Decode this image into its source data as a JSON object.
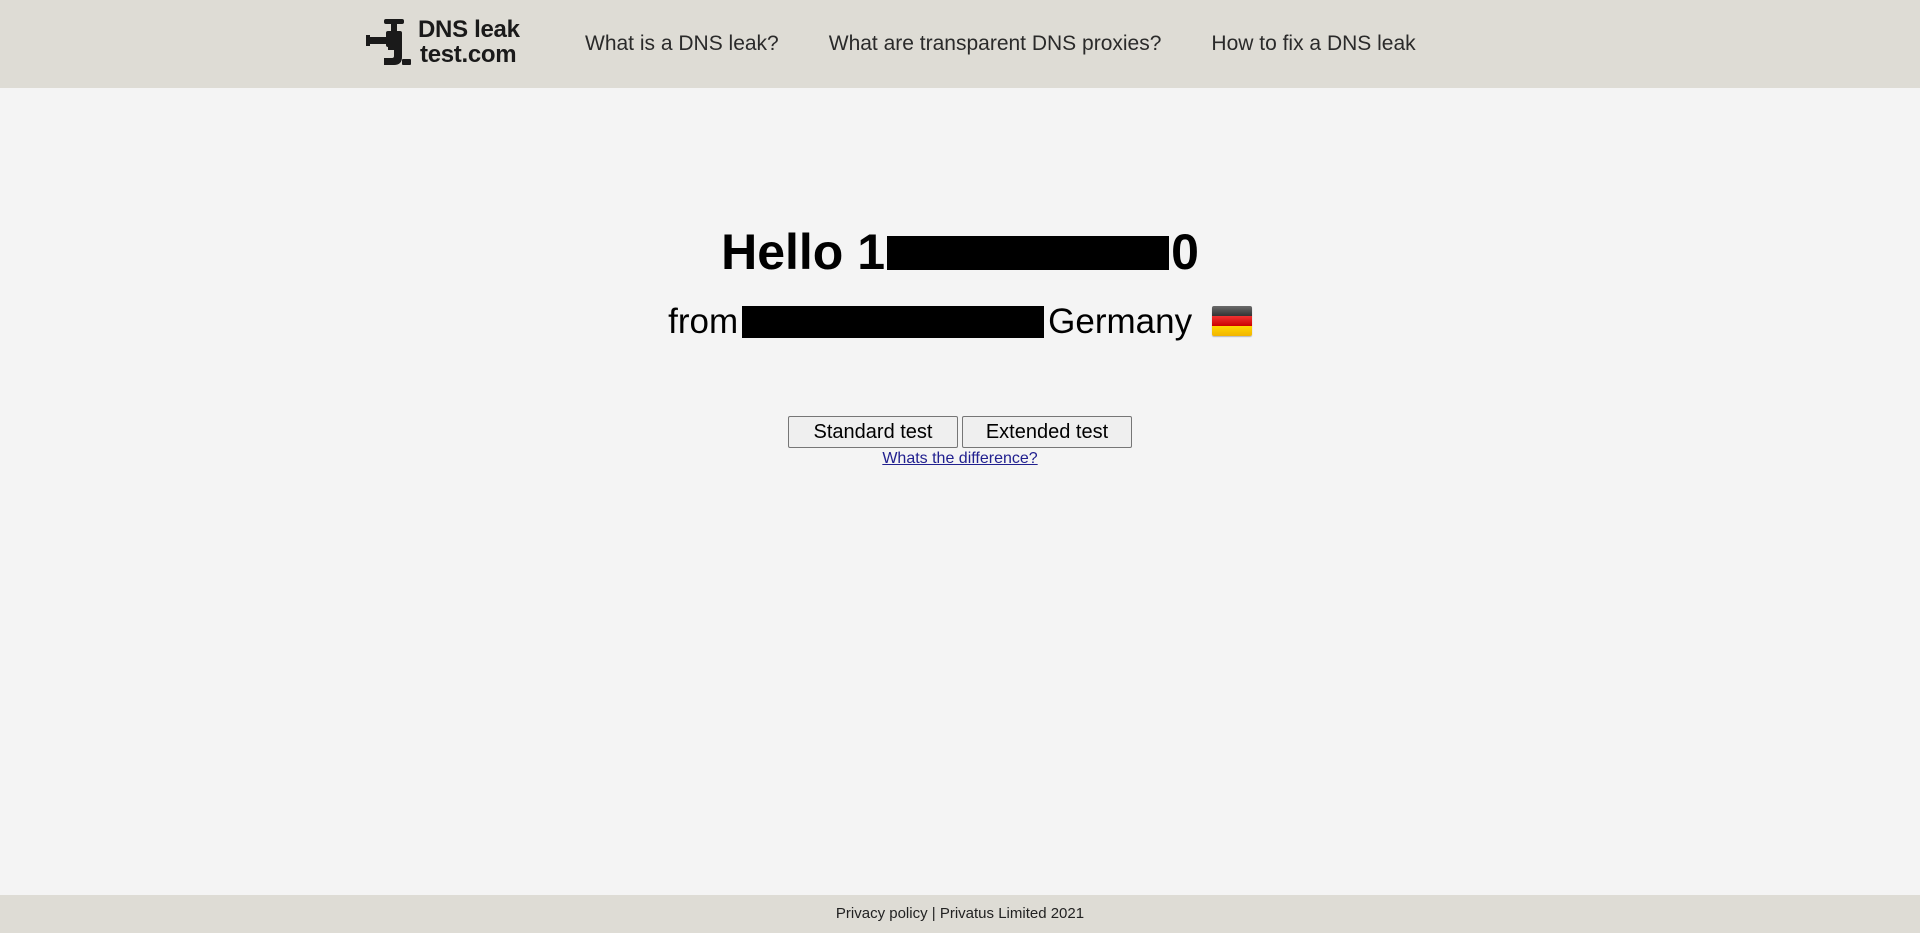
{
  "header": {
    "logo": {
      "line1": "DNS leak",
      "line2": "test.com",
      "icon": "faucet-icon"
    },
    "nav": [
      {
        "label": "What is a DNS leak?"
      },
      {
        "label": "What are transparent DNS proxies?"
      },
      {
        "label": "How to fix a DNS leak"
      }
    ]
  },
  "greeting": {
    "hello_prefix": "Hello 1",
    "hello_suffix": "0",
    "from_prefix": "from",
    "country": "Germany",
    "flag_icon": "germany-flag-icon",
    "flag_colors": [
      "#000000",
      "#dd0000",
      "#ffce00"
    ]
  },
  "actions": {
    "standard_label": "Standard test",
    "extended_label": "Extended test",
    "difference_link": "Whats the difference?"
  },
  "footer": {
    "privacy_label": "Privacy policy",
    "separator": " | ",
    "company": "Privatus Limited 2021"
  }
}
